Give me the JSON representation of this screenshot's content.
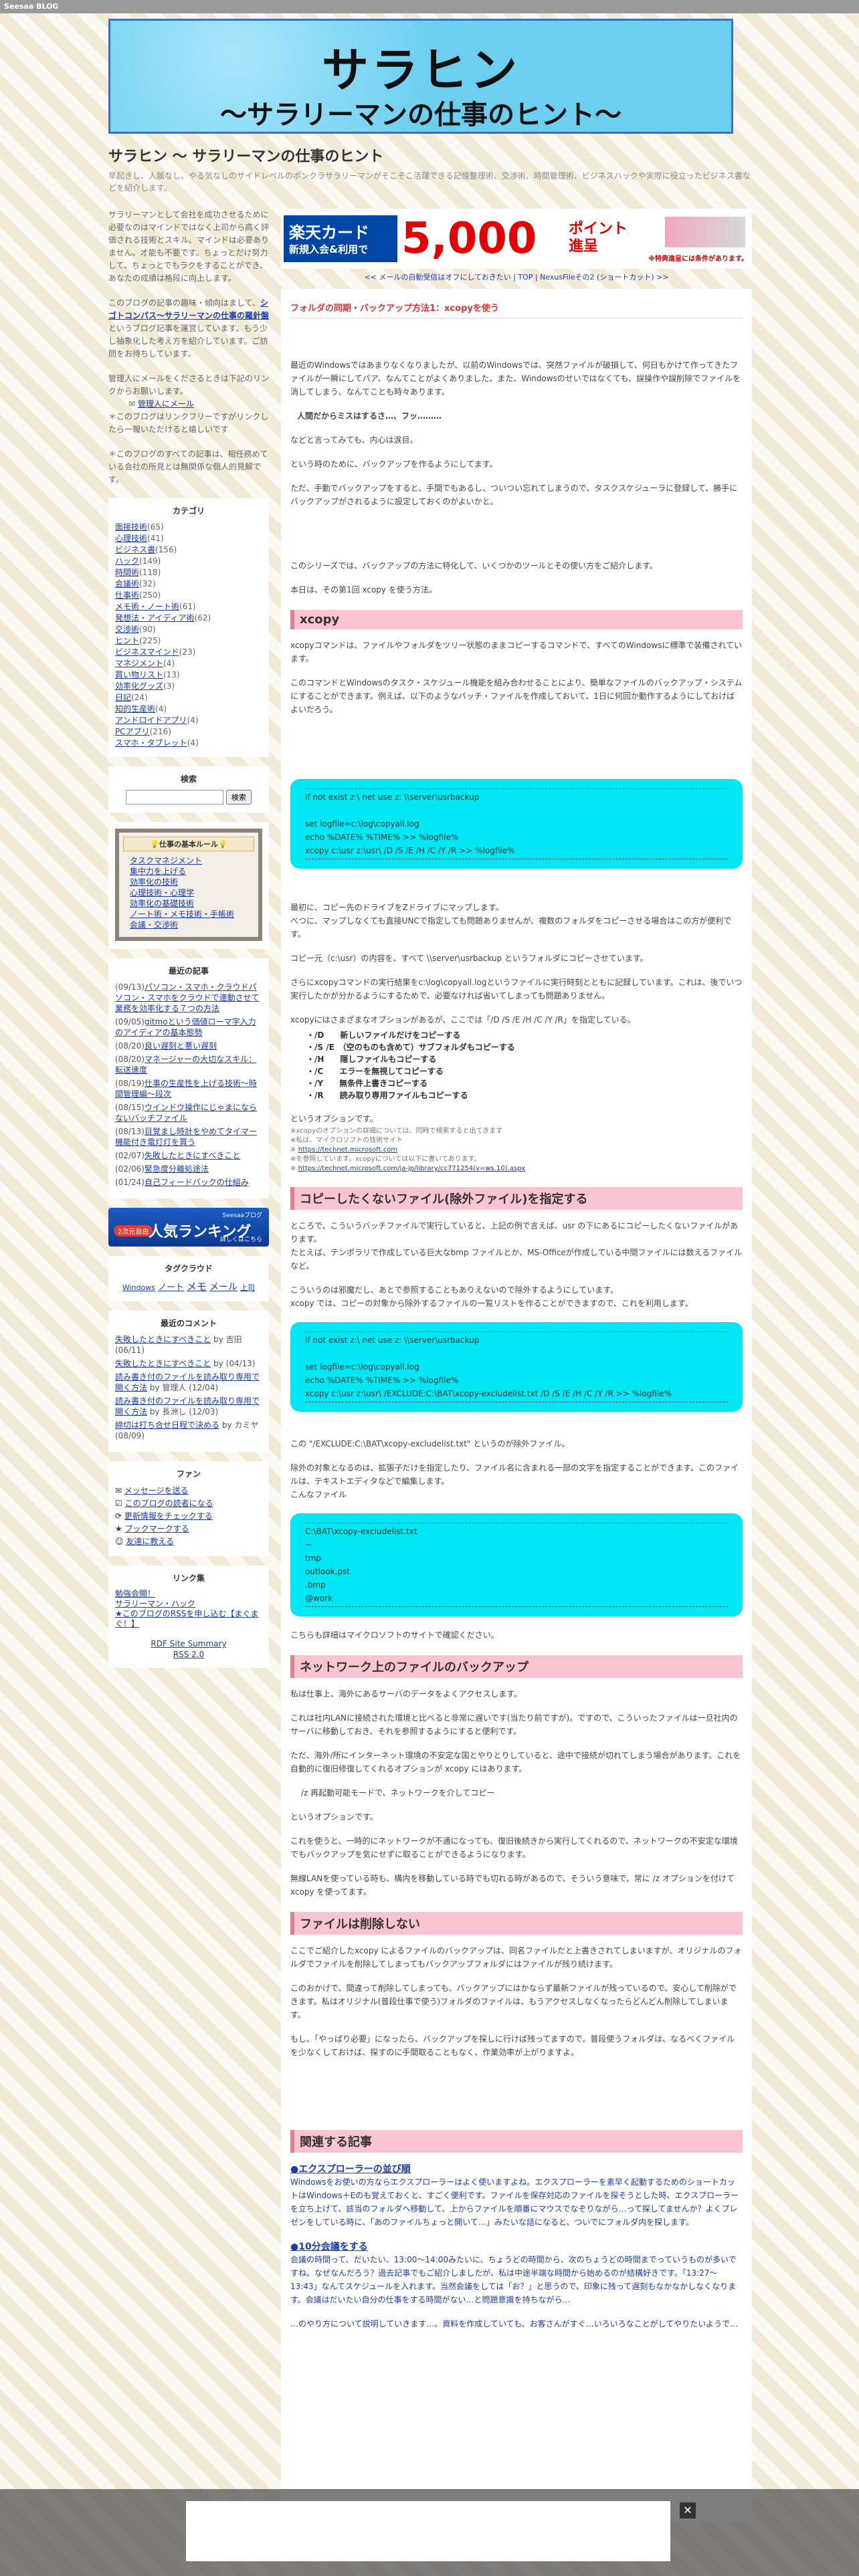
{
  "topbar": {
    "brand": "Seesaa BLOG"
  },
  "banner": {
    "title": "サラヒン",
    "subtitle": "〜サラリーマンの仕事のヒント〜"
  },
  "site": {
    "title": "サラヒン 〜 サラリーマンの仕事のヒント",
    "description": "早起きし、人脈なし、やる気なしのサイドレベルのポンクラサラリーマンがそこそこ活躍できる記憶整理術、交渉術、時間管理術、ビジネスハックや実際に役立ったビジネス書などを紹介します。"
  },
  "intro": {
    "p1": "サラリーマンとして会社を成功させるために必要なのはマインドではなく上司から高く評価される技術とスキル。マインドは必要ありません。才能も不要です。ちょっとだけ努力して、ちょっとでもラクをすることができ、あなたの成績は格段に向上します。",
    "p2_pre": "このブログの記事の趣味・傾向はまして、",
    "p2_link": "シゴトコンパス〜サラリーマンの仕事の羅針盤",
    "p2_post": "というブログ記事を運営しています。もう少し抽象化した考え方を紹介しています。ご訪問をお待ちしています。",
    "p3": "管理人にメールをくださるときは下記のリンクからお願いします。",
    "p3_link": "管理人にメール",
    "p4": "＊このブログはリンクフリーですがリンクしたら一報いただけると嬉しいです",
    "p5": "＊このブログのすべての記事は、相任務めている会社の所見とは無関係な個人的見解です。"
  },
  "categories": {
    "title": "カテゴリ",
    "items": [
      {
        "label": "面接技術",
        "count": "(65)"
      },
      {
        "label": "心理技術",
        "count": "(41)"
      },
      {
        "label": "ビジネス書",
        "count": "(156)"
      },
      {
        "label": "ハック",
        "count": "(149)"
      },
      {
        "label": "時間術",
        "count": "(118)"
      },
      {
        "label": "会議術",
        "count": "(32)"
      },
      {
        "label": "仕事術",
        "count": "(250)"
      },
      {
        "label": "メモ術・ノート術",
        "count": "(61)"
      },
      {
        "label": "発想法・アイディア術",
        "count": "(62)"
      },
      {
        "label": "交渉術",
        "count": "(90)"
      },
      {
        "label": "ヒント",
        "count": "(225)"
      },
      {
        "label": "ビジネスマインド",
        "count": "(23)"
      },
      {
        "label": "マネジメント",
        "count": "(4)"
      },
      {
        "label": "買い物リスト",
        "count": "(13)"
      },
      {
        "label": "効率化グッズ",
        "count": "(3)"
      },
      {
        "label": "日記",
        "count": "(24)"
      },
      {
        "label": "知的生産術",
        "count": "(4)"
      },
      {
        "label": "アンドロイドアプリ",
        "count": "(4)"
      },
      {
        "label": "PCアプリ",
        "count": "(216)"
      },
      {
        "label": "スマホ・タブレット",
        "count": "(4)"
      }
    ]
  },
  "search": {
    "title": "検索",
    "button": "検索",
    "placeholder": ""
  },
  "rules": {
    "title": "仕事の基本ルール",
    "items": [
      "タスクマネジメント",
      "集中力を上げる",
      "効率化の技術",
      "心理技術・心理学",
      "効率化の基礎技術",
      "ノート術・メモ技術・手帳術",
      "会議・交渉術"
    ]
  },
  "recent": {
    "title": "最近の記事",
    "items": [
      {
        "date": "(09/13)",
        "text": "パソコン・スマホ・クラウドパソコン・スマホをクラウドで連動させて業務を効率化する７つの方法"
      },
      {
        "date": "(09/05)",
        "text": "gitmoという価値ローマ字入力のアイディアの基本態勢"
      },
      {
        "date": "(08/20)",
        "text": "良い遅刻と悪い遅刻"
      },
      {
        "date": "(08/20)",
        "text": "マネージャーの大切なスキル：転送速度"
      },
      {
        "date": "(08/19)",
        "text": "仕事の生産性を上げる技術〜時間管理編〜段次"
      },
      {
        "date": "(08/15)",
        "text": "ウインドウ操作にじゃまにならないバッチファイル"
      },
      {
        "date": "(08/13)",
        "text": "目覚まし時計をやめてタイマー機能付き電灯灯を買う"
      },
      {
        "date": "(02/07)",
        "text": "失敗したときにすべきこと"
      },
      {
        "date": "(02/06)",
        "text": "緊急度分離処途法"
      },
      {
        "date": "(01/24)",
        "text": "自己フィードバックの仕組み"
      }
    ]
  },
  "ranking": {
    "top": "Seesaaブログ",
    "tag": "2次元自由",
    "label": "人気ランキング",
    "more": "詳しくはこちら"
  },
  "tags": {
    "title": "タグクラウド",
    "items": [
      "Windows",
      "ノート",
      "メモ",
      "メール",
      "上司"
    ]
  },
  "comments": {
    "title": "最近のコメント",
    "items": [
      {
        "link": "失敗したときにすべきこと",
        "by": "by 吉田 (06/11)"
      },
      {
        "link": "失敗したときにすべきこと",
        "by": "by (04/13)"
      },
      {
        "link": "読み書き付のファイルを読み取り専用で開く方法",
        "by": "by 管理人 (12/04)"
      },
      {
        "link": "読み書き付のファイルを読み取り専用で開く方法",
        "by": "by 長洲し (12/03)"
      },
      {
        "link": "締切は打ち合せ日程で決める",
        "by": "by カミヤ (08/09)"
      }
    ]
  },
  "fan": {
    "title": "ファン",
    "items": [
      "メッセージを送る",
      "このブログの読者になる",
      "更新情報をチェックする",
      "ブックマークする",
      "友達に教える"
    ]
  },
  "links": {
    "title": "リンク集",
    "items": [
      "勉強会開！",
      "サラリーマン・ハック",
      "★このブログのRSSを申し込む【まぐまぐ！】"
    ]
  },
  "rss": {
    "items": [
      "RDF Site Summary",
      "RSS 2.0"
    ]
  },
  "ad": {
    "brand": "楽天カード",
    "sub": "新規入会&利用で",
    "points": "5,000",
    "unit": "ポイント進呈",
    "note": "※特典進呈には条件があります。"
  },
  "ad_under": "<< メールの自動受信はオフにしておきたい | TOP | NexusFileその2 (ショートカット) >>",
  "article": {
    "title": "フォルダの同期・バックアップ方法1：xcopyを使う",
    "p1": "最近のWindowsではあまりなくなりましたが、以前のWindowsでは、突然ファイルが破損して、何日もかけて作ってきたファイルが一瞬にしてパア、なんてことがよくありました。また、Windowsのせいではなくても、誤操作や誤削除でファイルを消してしまう、なんてことも時々あります。",
    "p2": "人間だからミスはするさ…、フッ………",
    "p3": "などと言ってみても、内心は涙目。",
    "p4": "という時のために、バックアップを作るようにしてます。",
    "p5": "ただ、手動でバックアップをすると、手間でもあるし、ついつい忘れてしまうので、タスクスケジューラに登録して、勝手にバックアップがされるように設定しておくのがよいかと。",
    "p6": "このシリーズでは、バックアップの方法に特化して、いくつかのツールとその使い方をご紹介します。",
    "p7": "本日は、その第1回 xcopy を使う方法。",
    "h_xcopy": "xcopy",
    "p8": "xcopyコマンドは、ファイルやフォルダをツリー状態のままコピーするコマンドで、すべてのWindowsに標準で装備されています。",
    "p9": "このコマンドとWindowsのタスク・スケジュール機能を組み合わせることにより、簡単なファイルのバックアップ・システムにすることができます。例えば、以下のようなバッチ・ファイルを作成しておいて、1日に何回か動作するようにしておけばよいだろう。",
    "code1": [
      "if not exist z:\\ net use z: \\\\server\\usrbackup",
      "",
      "set logfile=c:\\log\\copyall.log",
      "echo %DATE% %TIME% >> %logfile%",
      "xcopy c:\\usr z:\\usr\\ /D /S /E /H /C /Y /R >> %logfile%"
    ],
    "p10": "最初に、コピー先のドライブをZドライブにマップします。",
    "p11": "べつに、マップしなくても直接UNCで指定しても問題ありませんが、複数のフォルダをコピーさせる場合はこの方が便利です。",
    "p12": "コピー元（c:\\usr）の内容を、すべて \\\\server\\usrbackup というフォルダにコピーさせています。",
    "p13": "さらにxcopyコマンドの実行結果をc:\\log\\copyall.logというファイルに実行時刻とともに記録しています。これは、後でいつ実行したかが分かるようにするためで、必要なければ省いてしまっても問題ありません。",
    "p14": "xcopyにはさまざまなオプションがあるが、ここでは「/D /S /E /H /C /Y /R」を指定している。",
    "opts": [
      "・/D　　新しいファイルだけをコピーする",
      "・/S /E　（空のものも含めて）サブフォルダもコピーする",
      "・/H　　隠しファイルもコピーする",
      "・/C　　エラーを無視してコピーする",
      "・/Y　　無条件上書きコピーする",
      "・/R　　読み取り専用ファイルもコピーする"
    ],
    "p15": "というオプションです。",
    "p16": "※xcopyのオプションの詳細については、同時で検索すると出てきます",
    "p16b": "※私は、マイクロソフトの技術サイト",
    "link1": "https://technet.microsoft.com",
    "p16c": "※を参照しています。xcopyについては以下に書いてあります。",
    "link2": "https://technet.microsoft.com/ja-jp/library/cc771254(v=ws.10).aspx",
    "h_exclude": "コピーしたくないファイル(除外ファイル)を指定する",
    "p17": "ところで、こういうバッチファイルで実行していると、上記の例で言えば、usr の下にあるにコピーしたくないファイルがあります。",
    "p18": "たとえば、テンポラリで作成している巨大なbmp ファイルとか、MS-Officeが作成している中間ファイルには数えるファイルなど。",
    "p19": "こういうのは邪魔だし、あとで参照することもありえないので除外するようにしています。",
    "p20": "xcopy では、コピーの対象から除外するファイルの一覧リストを作ることができますので、これを利用します。",
    "code2": [
      "if not exist z:\\ net use z: \\\\server\\usrbackup",
      "",
      "set logfile=c:\\log\\copyall.log",
      "echo %DATE% %TIME% >> %logfile%",
      "xcopy c:\\usr z:\\usr\\ /EXCLUDE:C:\\BAT\\xcopy-excludelist.txt /D /S /E /H /C /Y /R >> %logfile%"
    ],
    "p21": "この \"/EXCLUDE:C:\\BAT\\xcopy-excludelist.txt\" というのが除外ファイル。",
    "p22": "除外の対象となるのは、拡張子だけを指定したり、ファイル名に含まれる一部の文字を指定することができます。このファイルは、テキストエディタなどで編集します。",
    "p23": "こんなファイル",
    "code3": [
      "C:\\BAT\\xcopy-excludelist.txt",
      "~",
      "tmp",
      "outlook.pst",
      ".bmp",
      "@work"
    ],
    "p24": "こちらも詳細はマイクロソフトのサイトで確認ください。",
    "h_network": "ネットワーク上のファイルのバックアップ",
    "p25": "私は仕事上、海外にあるサーバのデータをよくアクセスします。",
    "p26": "これは社内LANに接続された環境と比べると非常に遅いです(当たり前ですが)。ですので、こういったファイルは一旦社内のサーバに移動しておき、それを参照するようにすると便利です。",
    "p27": "ただ、海外/所にインターネット環境の不安定な国とやりとりしていると、途中で接続が切れてしまう場合があります。これを自動的に復旧修復してくれるオプションが xcopy にはあります。",
    "p28": "/z 再起動可能モードで、ネットワークを介してコピー",
    "p29": "というオプションです。",
    "p30": "これを使うと、一時的にネットワークが不通になっても、復旧後続きから実行してくれるので、ネットワークの不安定な環境でもバックアップを気にせずに取ることができるようになります。",
    "p31": "無線LANを使っている時も、構内を移動している時でも切れる時があるので、そういう意味で、常に /z オプションを付けて xcopy を使ってます。",
    "h_nodelete": "ファイルは削除しない",
    "p32": "ここでご紹介したxcopy によるファイルのバックアップは、同名ファイルだと上書きされてしまいますが、オリジナルのフォルダでファイルを削除してしまってもバックアップフォルダにはファイルが残り続けます。",
    "p33": "このおかげで、間違って削除してしまっても、バックアップにはかならず最新ファイルが残っているので、安心して削除ができます。私はオリジナル(普段仕事で使う)フォルダのファイルは、もうアクセスしなくなったらどんどん削除してしまいます。",
    "p34": "もし、「やっぱり必要」になったら、バックアップを探しに行けば残ってますので。普段使うフォルダは、なるべくファイルを少なくしておけば、探すのに手間取ることもなく、作業効率が上がりますよ。",
    "h_related": "関連する記事",
    "rel1_title": "●エクスプローラーの並び順",
    "rel1_text": "Windowsをお使いの方ならエクスプローラーはよく使いますよね。エクスプローラーを素早く起動するためのショートカットはWindows＋Eのも覚えておくと、すごく便利です。ファイルを保存対応のファイルを探そうとした時、エクスプローラーを立ち上げて、該当のフォルダへ移動して、上からファイルを順番にマウスでなぞりながら…って探してませんか？よくプレゼンをしている時に、「あのファイルちょっと開いて…」みたいな話になると、ついでにフォルダ内を探します。",
    "rel2_title": "●10分会議をする",
    "rel2_text": "会議の時間って、だいたい、13:00〜14:00みたいに、ちょうどの時間から、次のちょうどの時間までっていうものが多いですね。なぜなんだろう？過去記事でもご紹介しましたが、私は中途半端な時間から始めるのが結構好きです。「13:27〜13:43」なんてスケジュールを入れます。当然会議をしては「お？」と思うので、印象に残って遅刻もなかなかしなくなります。会議はだいたい自分の仕事をする時間がない…と問題意識を持ちながら…",
    "rel3_text": "…のやり方について説明していきます…。資料を作成していても、お客さんがすぐ…いろいろなことがしてやりたいようで…"
  },
  "bottom_ad": {
    "close": "✕"
  }
}
